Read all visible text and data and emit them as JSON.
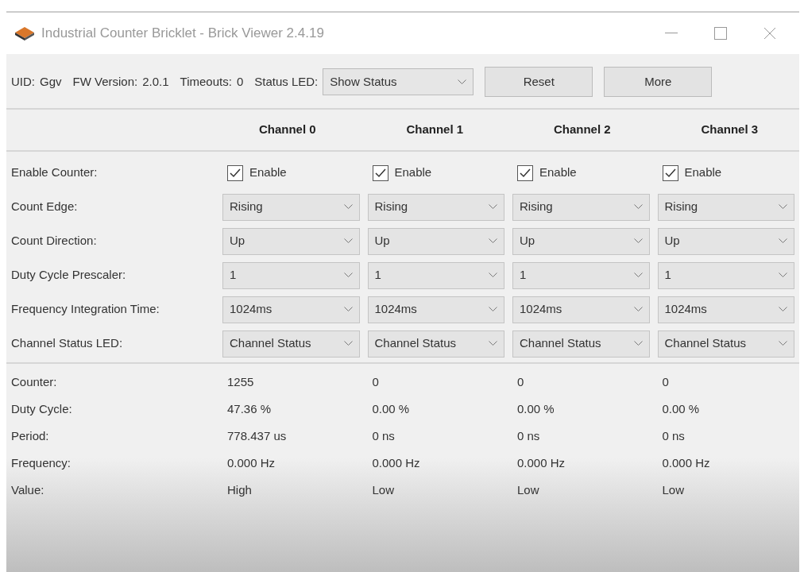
{
  "window": {
    "title": "Industrial Counter Bricklet - Brick Viewer 2.4.19"
  },
  "toolbar": {
    "uid_label": "UID:",
    "uid": "Ggv",
    "fw_label": "FW Version:",
    "fw": "2.0.1",
    "timeouts_label": "Timeouts:",
    "timeouts": "0",
    "status_led_label": "Status LED:",
    "status_led": "Show Status",
    "buttons": [
      "Reset",
      "More"
    ]
  },
  "channels": [
    "Channel 0",
    "Channel 1",
    "Channel 2",
    "Channel 3"
  ],
  "settings": [
    {
      "label": "Enable Counter:",
      "kind": "checkbox",
      "cells": [
        {
          "text": "Enable",
          "checked": true
        },
        {
          "text": "Enable",
          "checked": true
        },
        {
          "text": "Enable",
          "checked": true
        },
        {
          "text": "Enable",
          "checked": true
        }
      ]
    },
    {
      "label": "Count Edge:",
      "kind": "select",
      "cells": [
        {
          "text": "Rising"
        },
        {
          "text": "Rising"
        },
        {
          "text": "Rising"
        },
        {
          "text": "Rising"
        }
      ]
    },
    {
      "label": "Count Direction:",
      "kind": "select",
      "cells": [
        {
          "text": "Up"
        },
        {
          "text": "Up"
        },
        {
          "text": "Up"
        },
        {
          "text": "Up"
        }
      ]
    },
    {
      "label": "Duty Cycle Prescaler:",
      "kind": "select",
      "cells": [
        {
          "text": "1"
        },
        {
          "text": "1"
        },
        {
          "text": "1"
        },
        {
          "text": "1"
        }
      ]
    },
    {
      "label": "Frequency Integration Time:",
      "kind": "select",
      "cells": [
        {
          "text": "1024ms"
        },
        {
          "text": "1024ms"
        },
        {
          "text": "1024ms"
        },
        {
          "text": "1024ms"
        }
      ]
    },
    {
      "label": "Channel Status LED:",
      "kind": "select",
      "cells": [
        {
          "text": "Channel Status"
        },
        {
          "text": "Channel Status"
        },
        {
          "text": "Channel Status"
        },
        {
          "text": "Channel Status"
        }
      ]
    }
  ],
  "readings": [
    {
      "label": "Counter:",
      "values": [
        "1255",
        "0",
        "0",
        "0"
      ]
    },
    {
      "label": "Duty Cycle:",
      "values": [
        "47.36 %",
        "0.00 %",
        "0.00 %",
        "0.00 %"
      ]
    },
    {
      "label": "Period:",
      "values": [
        "778.437 us",
        "0 ns",
        "0 ns",
        "0 ns"
      ]
    },
    {
      "label": "Frequency:",
      "values": [
        "0.000 Hz",
        "0.000 Hz",
        "0.000 Hz",
        "0.000 Hz"
      ]
    },
    {
      "label": "Value:",
      "values": [
        "High",
        "Low",
        "Low",
        "Low"
      ]
    }
  ]
}
